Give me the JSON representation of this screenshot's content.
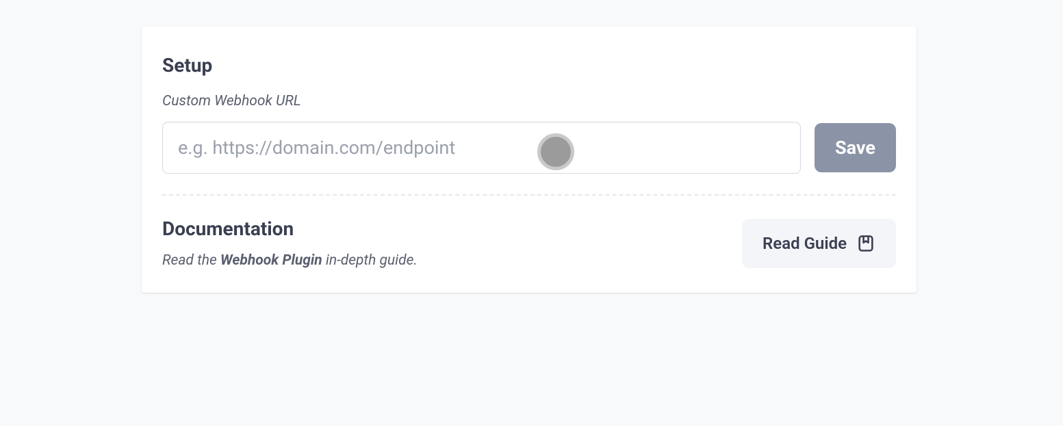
{
  "setup": {
    "heading": "Setup",
    "field_label": "Custom Webhook URL",
    "url_placeholder": "e.g. https://domain.com/endpoint",
    "url_value": "",
    "save_label": "Save"
  },
  "documentation": {
    "heading": "Documentation",
    "text_prefix": "Read the ",
    "text_bold": "Webhook Plugin",
    "text_suffix": " in-depth guide.",
    "read_guide_label": "Read Guide"
  }
}
